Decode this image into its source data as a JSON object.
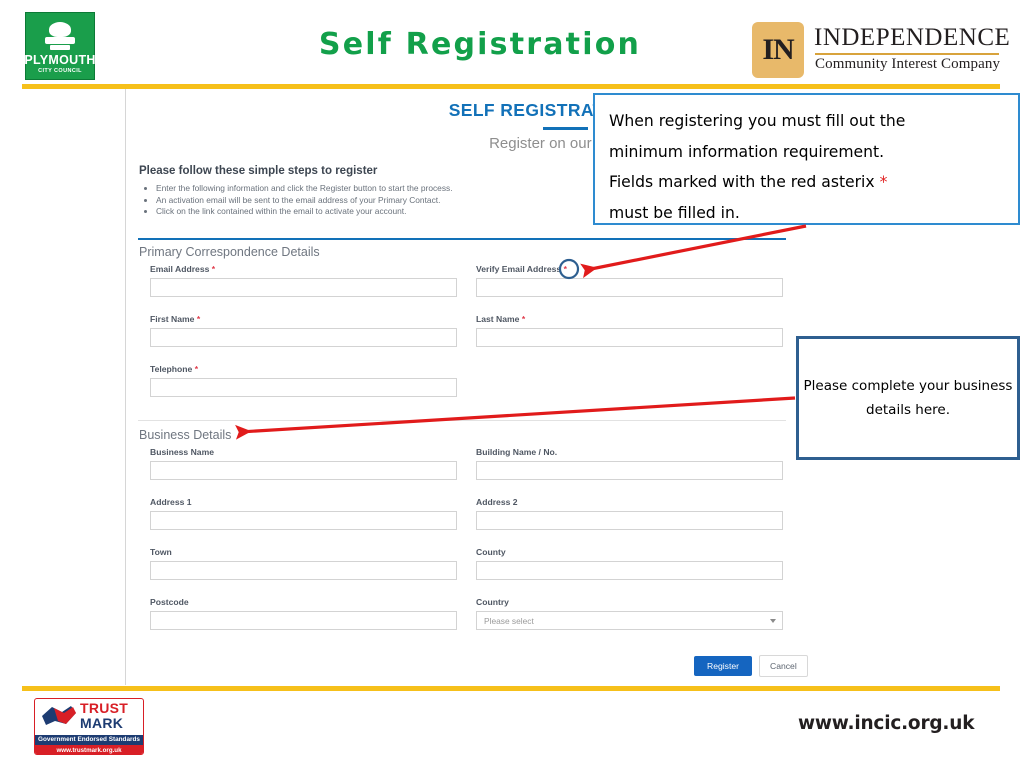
{
  "header": {
    "slide_title": "Self Registration",
    "plymouth_logo": {
      "name": "PLYMOUTH",
      "subtitle": "CITY COUNCIL"
    },
    "independence_logo": {
      "badge": "IN",
      "name": "INDEPENDENCE",
      "tagline": "Community Interest Company"
    }
  },
  "form": {
    "title": "SELF REGISTRATION",
    "subtitle": "Register on our Supplier Network",
    "steps_heading": "Please follow these simple steps to register",
    "steps": [
      "Enter the following information and click the Register button to start the process.",
      "An activation email will be sent to the email address of your Primary Contact.",
      "Click on the link contained within the email to activate your account."
    ],
    "sections": [
      {
        "heading": "Primary Correspondence Details",
        "rows": [
          [
            {
              "label": "Email Address",
              "required": true,
              "value": "",
              "type": "text"
            },
            {
              "label": "Verify Email Address",
              "required": true,
              "value": "",
              "type": "text"
            }
          ],
          [
            {
              "label": "First Name",
              "required": true,
              "value": "",
              "type": "text"
            },
            {
              "label": "Last Name",
              "required": true,
              "value": "",
              "type": "text"
            }
          ],
          [
            {
              "label": "Telephone",
              "required": true,
              "value": "",
              "type": "text"
            }
          ]
        ]
      },
      {
        "heading": "Business Details",
        "rows": [
          [
            {
              "label": "Business Name",
              "required": false,
              "value": "",
              "type": "text"
            },
            {
              "label": "Building Name / No.",
              "required": false,
              "value": "",
              "type": "text"
            }
          ],
          [
            {
              "label": "Address 1",
              "required": false,
              "value": "",
              "type": "text"
            },
            {
              "label": "Address 2",
              "required": false,
              "value": "",
              "type": "text"
            }
          ],
          [
            {
              "label": "Town",
              "required": false,
              "value": "",
              "type": "text"
            },
            {
              "label": "County",
              "required": false,
              "value": "",
              "type": "text"
            }
          ],
          [
            {
              "label": "Postcode",
              "required": false,
              "value": "",
              "type": "text"
            },
            {
              "label": "Country",
              "required": false,
              "value": "Please select",
              "type": "select"
            }
          ]
        ]
      }
    ],
    "buttons": {
      "register": "Register",
      "cancel": "Cancel"
    }
  },
  "annotations": {
    "required_note": {
      "line1": "When registering you must fill out the",
      "line2": "minimum information requirement.",
      "line3_pre": "Fields marked with the red asterix ",
      "line3_asterix": "*",
      "line4": "must be filled in."
    },
    "business_note": "Please complete your business details here."
  },
  "footer": {
    "trustmark": {
      "word_trust": "TRUST",
      "word_mark": "MARK",
      "band": "Government Endorsed Standards",
      "url": "www.trustmark.org.uk"
    },
    "website": "www.incic.org.uk"
  },
  "colors": {
    "title_green": "#12a04a",
    "yellow_rule": "#f6c01a",
    "form_blue": "#1271b8",
    "required_red": "#e03b4b",
    "callout_blue": "#2e8bd0",
    "callout_navy": "#2e5f90",
    "arrow_red": "#e11b1b",
    "register_blue": "#1565c0"
  }
}
